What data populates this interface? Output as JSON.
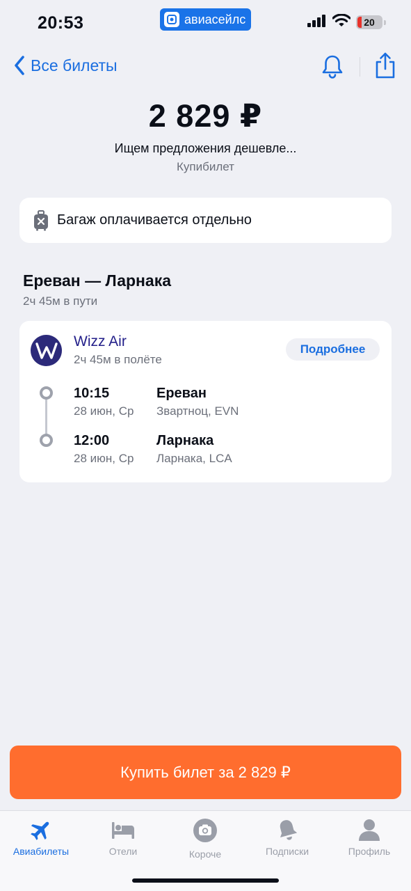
{
  "status_bar": {
    "time": "20:53",
    "brand": "авиасейлс",
    "battery": "20",
    "icons": [
      "signal-icon",
      "wifi-icon",
      "battery-icon"
    ]
  },
  "nav": {
    "back_label": "Все билеты",
    "icons": [
      "chevron-left-icon",
      "bell-icon",
      "share-icon"
    ]
  },
  "header": {
    "price": "2 829 ₽",
    "searching": "Ищем предложения дешевле...",
    "seller": "Купибилет"
  },
  "baggage": {
    "text": "Багаж оплачивается отдельно",
    "icon": "luggage-icon"
  },
  "route": {
    "title": "Ереван — Ларнака",
    "duration": "2ч 45м в пути"
  },
  "flight": {
    "airline": "Wizz Air",
    "duration": "2ч 45м в полёте",
    "details_label": "Подробнее",
    "segments": [
      {
        "time": "10:15",
        "date": "28 июн, Ср",
        "city": "Ереван",
        "airport": "Звартноц, EVN"
      },
      {
        "time": "12:00",
        "date": "28 июн, Ср",
        "city": "Ларнака",
        "airport": "Ларнака, LCA"
      }
    ]
  },
  "buy_button": {
    "label": "Купить билет за 2 829 ₽"
  },
  "tabbar": {
    "items": [
      {
        "label": "Авиабилеты",
        "icon": "plane-icon",
        "active": true
      },
      {
        "label": "Отели",
        "icon": "bed-icon",
        "active": false
      },
      {
        "label": "Короче",
        "icon": "camera-icon",
        "active": false
      },
      {
        "label": "Подписки",
        "icon": "bell-icon",
        "active": false
      },
      {
        "label": "Профиль",
        "icon": "profile-icon",
        "active": false
      }
    ]
  },
  "colors": {
    "accent": "#1a6ee0",
    "buy": "#ff6d2e",
    "background": "#eff0f5",
    "airline": "#24208a"
  }
}
